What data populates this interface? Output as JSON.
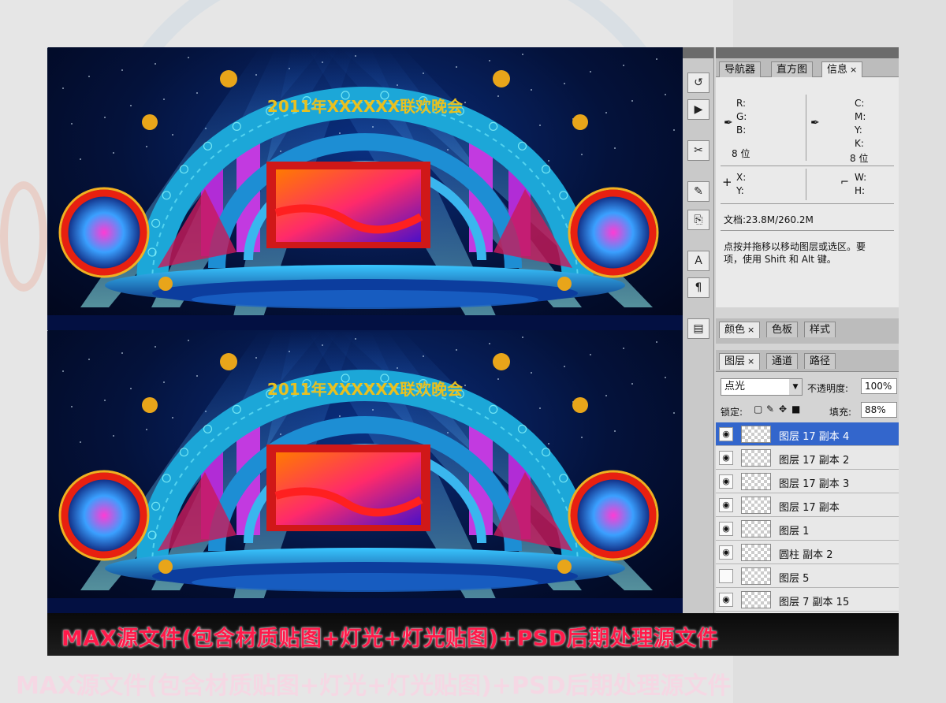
{
  "stage": {
    "banner": "2011年XXXXXX联欢晚会",
    "scene_count": 2
  },
  "photoshop": {
    "info_tabs": [
      {
        "label": "导航器",
        "active": false
      },
      {
        "label": "直方图",
        "active": false
      },
      {
        "label": "信息",
        "active": true
      }
    ],
    "info": {
      "rgb": [
        "R:",
        "G:",
        "B:"
      ],
      "cmyk": [
        "C:",
        "M:",
        "Y:",
        "K:"
      ],
      "bit_left": "8 位",
      "bit_right": "8 位",
      "xy": [
        "X:",
        "Y:"
      ],
      "wh": [
        "W:",
        "H:"
      ],
      "doc": "文档:23.8M/260.2M",
      "hint_line1": "点按并拖移以移动图层或选区。要",
      "hint_line2": "项，使用 Shift 和 Alt 键。"
    },
    "color_tabs": [
      {
        "label": "颜色",
        "active": true
      },
      {
        "label": "色板",
        "active": false
      },
      {
        "label": "样式",
        "active": false
      }
    ],
    "layers_tabs": [
      {
        "label": "图层",
        "active": true
      },
      {
        "label": "通道",
        "active": false
      },
      {
        "label": "路径",
        "active": false
      }
    ],
    "blend_mode": "点光",
    "opacity_label": "不透明度:",
    "opacity_value": "100%",
    "lock_label": "锁定:",
    "fill_label": "填充:",
    "fill_value": "88%",
    "layers": [
      {
        "name": "图层 17 副本 4",
        "visible": true,
        "selected": true
      },
      {
        "name": "图层 17 副本 2",
        "visible": true,
        "selected": false
      },
      {
        "name": "图层 17 副本 3",
        "visible": true,
        "selected": false
      },
      {
        "name": "图层 17 副本",
        "visible": true,
        "selected": false
      },
      {
        "name": "图层 1",
        "visible": true,
        "selected": false
      },
      {
        "name": "圆柱 副本 2",
        "visible": true,
        "selected": false
      },
      {
        "name": "图层 5",
        "visible": false,
        "selected": false
      },
      {
        "name": "图层 7 副本 15",
        "visible": true,
        "selected": false
      }
    ]
  },
  "caption": "MAX源文件(包含材质贴图+灯光+灯光贴图)+PSD后期处理源文件",
  "bottom_caption": "MAX源文件(包含材质贴图+灯光+灯光贴图)+PSD后期处理源文件"
}
